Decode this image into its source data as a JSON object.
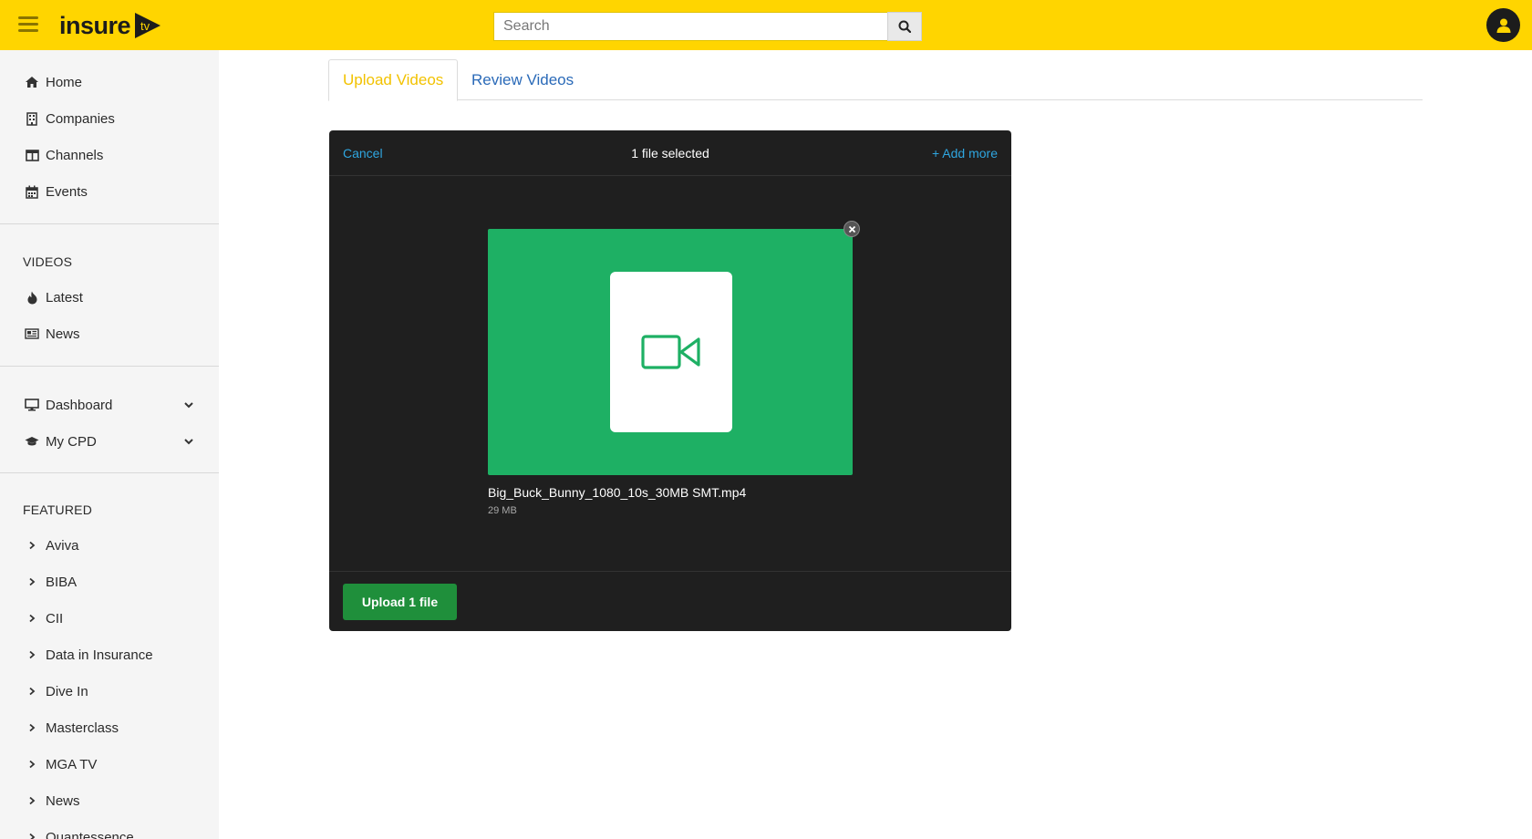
{
  "header": {
    "logo_text": "insure",
    "logo_badge": "tv",
    "search_placeholder": "Search",
    "brand_color": "#ffd500"
  },
  "sidebar": {
    "main_items": [
      {
        "label": "Home",
        "icon": "home-icon"
      },
      {
        "label": "Companies",
        "icon": "building-icon"
      },
      {
        "label": "Channels",
        "icon": "columns-icon"
      },
      {
        "label": "Events",
        "icon": "calendar-icon"
      }
    ],
    "videos_title": "VIDEOS",
    "video_items": [
      {
        "label": "Latest",
        "icon": "fire-icon"
      },
      {
        "label": "News",
        "icon": "newspaper-icon"
      }
    ],
    "account_items": [
      {
        "label": "Dashboard",
        "icon": "monitor-icon"
      },
      {
        "label": "My CPD",
        "icon": "graduation-cap-icon"
      }
    ],
    "featured_title": "FEATURED",
    "featured_items": [
      "Aviva",
      "BIBA",
      "CII",
      "Data in Insurance",
      "Dive In",
      "Masterclass",
      "MGA TV",
      "News",
      "Quantessence"
    ]
  },
  "tabs": [
    {
      "label": "Upload Videos",
      "active": true
    },
    {
      "label": "Review Videos",
      "active": false
    }
  ],
  "uploader": {
    "cancel_label": "Cancel",
    "status_text": "1 file selected",
    "add_more_label": "+ Add more",
    "file": {
      "name": "Big_Buck_Bunny_1080_10s_30MB SMT.mp4",
      "size": "29 MB",
      "icon": "video-camera-icon",
      "card_color": "#1eb064"
    },
    "upload_button_label": "Upload 1 file"
  }
}
